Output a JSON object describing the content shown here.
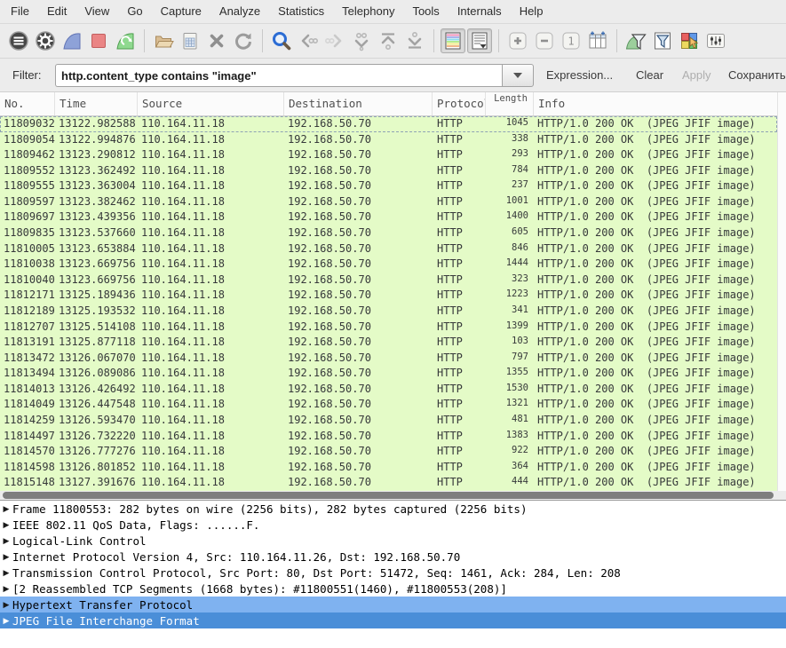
{
  "menu": {
    "items": [
      "File",
      "Edit",
      "View",
      "Go",
      "Capture",
      "Analyze",
      "Statistics",
      "Telephony",
      "Tools",
      "Internals",
      "Help"
    ]
  },
  "toolbar": {
    "icon_names": [
      "interfaces-icon",
      "capture-options-icon",
      "start-capture-icon",
      "stop-capture-icon",
      "restart-capture-icon",
      "open-file-icon",
      "save-file-icon",
      "close-file-icon",
      "reload-icon",
      "find-packet-icon",
      "go-back-icon",
      "go-forward-icon",
      "go-to-packet-icon",
      "go-to-top-icon",
      "go-to-bottom-icon",
      "colorize-icon",
      "auto-scroll-icon",
      "zoom-in-icon",
      "zoom-out-icon",
      "zoom-100-icon",
      "resize-columns-icon",
      "capture-filters-icon",
      "display-filters-icon",
      "coloring-rules-icon",
      "preferences-icon"
    ]
  },
  "filter": {
    "label": "Filter:",
    "value": "http.content_type contains \"image\"",
    "expression_button": "Expression...",
    "clear_button": "Clear",
    "apply_button": "Apply",
    "save_button": "Сохранить"
  },
  "packet_list": {
    "columns": [
      "No.",
      "Time",
      "Source",
      "Destination",
      "Protocol",
      "Length",
      "Info"
    ],
    "rows": [
      [
        "11809032",
        "13122.982588",
        "110.164.11.18",
        "192.168.50.70",
        "HTTP",
        "1045",
        "HTTP/1.0 200 OK  (JPEG JFIF image)"
      ],
      [
        "11809054",
        "13122.994876",
        "110.164.11.18",
        "192.168.50.70",
        "HTTP",
        "338",
        "HTTP/1.0 200 OK  (JPEG JFIF image)"
      ],
      [
        "11809462",
        "13123.290812",
        "110.164.11.18",
        "192.168.50.70",
        "HTTP",
        "293",
        "HTTP/1.0 200 OK  (JPEG JFIF image)"
      ],
      [
        "11809552",
        "13123.362492",
        "110.164.11.18",
        "192.168.50.70",
        "HTTP",
        "784",
        "HTTP/1.0 200 OK  (JPEG JFIF image)"
      ],
      [
        "11809555",
        "13123.363004",
        "110.164.11.18",
        "192.168.50.70",
        "HTTP",
        "237",
        "HTTP/1.0 200 OK  (JPEG JFIF image)"
      ],
      [
        "11809597",
        "13123.382462",
        "110.164.11.18",
        "192.168.50.70",
        "HTTP",
        "1001",
        "HTTP/1.0 200 OK  (JPEG JFIF image)"
      ],
      [
        "11809697",
        "13123.439356",
        "110.164.11.18",
        "192.168.50.70",
        "HTTP",
        "1400",
        "HTTP/1.0 200 OK  (JPEG JFIF image)"
      ],
      [
        "11809835",
        "13123.537660",
        "110.164.11.18",
        "192.168.50.70",
        "HTTP",
        "605",
        "HTTP/1.0 200 OK  (JPEG JFIF image)"
      ],
      [
        "11810005",
        "13123.653884",
        "110.164.11.18",
        "192.168.50.70",
        "HTTP",
        "846",
        "HTTP/1.0 200 OK  (JPEG JFIF image)"
      ],
      [
        "11810038",
        "13123.669756",
        "110.164.11.18",
        "192.168.50.70",
        "HTTP",
        "1444",
        "HTTP/1.0 200 OK  (JPEG JFIF image)"
      ],
      [
        "11810040",
        "13123.669756",
        "110.164.11.18",
        "192.168.50.70",
        "HTTP",
        "323",
        "HTTP/1.0 200 OK  (JPEG JFIF image)"
      ],
      [
        "11812171",
        "13125.189436",
        "110.164.11.18",
        "192.168.50.70",
        "HTTP",
        "1223",
        "HTTP/1.0 200 OK  (JPEG JFIF image)"
      ],
      [
        "11812189",
        "13125.193532",
        "110.164.11.18",
        "192.168.50.70",
        "HTTP",
        "341",
        "HTTP/1.0 200 OK  (JPEG JFIF image)"
      ],
      [
        "11812707",
        "13125.514108",
        "110.164.11.18",
        "192.168.50.70",
        "HTTP",
        "1399",
        "HTTP/1.0 200 OK  (JPEG JFIF image)"
      ],
      [
        "11813191",
        "13125.877118",
        "110.164.11.18",
        "192.168.50.70",
        "HTTP",
        "103",
        "HTTP/1.0 200 OK  (JPEG JFIF image)"
      ],
      [
        "11813472",
        "13126.067070",
        "110.164.11.18",
        "192.168.50.70",
        "HTTP",
        "797",
        "HTTP/1.0 200 OK  (JPEG JFIF image)"
      ],
      [
        "11813494",
        "13126.089086",
        "110.164.11.18",
        "192.168.50.70",
        "HTTP",
        "1355",
        "HTTP/1.0 200 OK  (JPEG JFIF image)"
      ],
      [
        "11814013",
        "13126.426492",
        "110.164.11.18",
        "192.168.50.70",
        "HTTP",
        "1530",
        "HTTP/1.0 200 OK  (JPEG JFIF image)"
      ],
      [
        "11814049",
        "13126.447548",
        "110.164.11.18",
        "192.168.50.70",
        "HTTP",
        "1321",
        "HTTP/1.0 200 OK  (JPEG JFIF image)"
      ],
      [
        "11814259",
        "13126.593470",
        "110.164.11.18",
        "192.168.50.70",
        "HTTP",
        "481",
        "HTTP/1.0 200 OK  (JPEG JFIF image)"
      ],
      [
        "11814497",
        "13126.732220",
        "110.164.11.18",
        "192.168.50.70",
        "HTTP",
        "1383",
        "HTTP/1.0 200 OK  (JPEG JFIF image)"
      ],
      [
        "11814570",
        "13126.777276",
        "110.164.11.18",
        "192.168.50.70",
        "HTTP",
        "922",
        "HTTP/1.0 200 OK  (JPEG JFIF image)"
      ],
      [
        "11814598",
        "13126.801852",
        "110.164.11.18",
        "192.168.50.70",
        "HTTP",
        "364",
        "HTTP/1.0 200 OK  (JPEG JFIF image)"
      ],
      [
        "11815148",
        "13127.391676",
        "110.164.11.18",
        "192.168.50.70",
        "HTTP",
        "444",
        "HTTP/1.0 200 OK  (JPEG JFIF image)"
      ]
    ]
  },
  "details": {
    "rows": [
      {
        "name": "frame",
        "text": "Frame 11800553: 282 bytes on wire (2256 bits), 282 bytes captured (2256 bits)",
        "state": "plain"
      },
      {
        "name": "ieee-80211",
        "text": "IEEE 802.11 QoS Data, Flags: ......F.",
        "state": "plain"
      },
      {
        "name": "llc",
        "text": "Logical-Link Control",
        "state": "plain"
      },
      {
        "name": "ip",
        "text": "Internet Protocol Version 4, Src: 110.164.11.26, Dst: 192.168.50.70",
        "state": "plain"
      },
      {
        "name": "tcp",
        "text": "Transmission Control Protocol, Src Port: 80, Dst Port: 51472, Seq: 1461, Ack: 284, Len: 208",
        "state": "plain"
      },
      {
        "name": "reassembled-segments",
        "text": "[2 Reassembled TCP Segments (1668 bytes): #11800551(1460), #11800553(208)]",
        "state": "plain"
      },
      {
        "name": "http",
        "text": "Hypertext Transfer Protocol",
        "state": "related"
      },
      {
        "name": "jpeg",
        "text": "JPEG File Interchange Format",
        "state": "selected"
      }
    ]
  },
  "colors": {
    "packet_row_bg": "#e4fbc7",
    "related_highlight_bg": "#7fb2f0",
    "selected_highlight_bg": "#4a8ed8",
    "selected_highlight_text": "#ffffff",
    "toolbar_bg": "#ececec"
  }
}
